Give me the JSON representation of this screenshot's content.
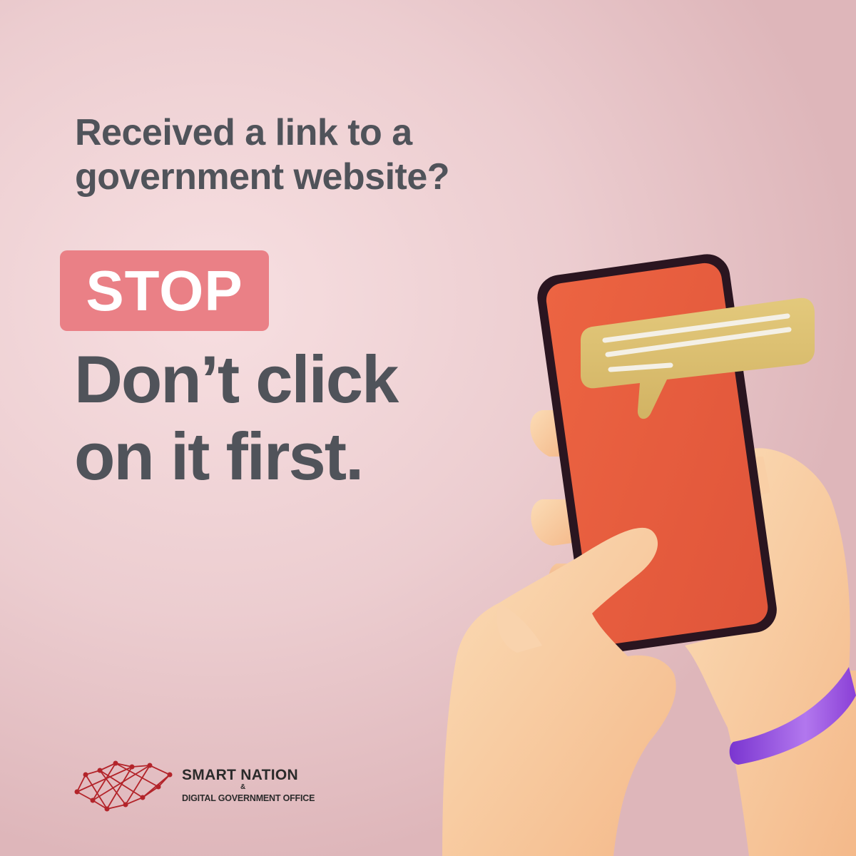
{
  "headline": {
    "question_line1": "Received a link to a",
    "question_line2": "government website?"
  },
  "stop_badge": {
    "label": "STOP",
    "color": "#ea8086"
  },
  "warning": {
    "line1": "Don’t click",
    "line2": "on it first."
  },
  "logo": {
    "line1": "SMART NATION",
    "ampersand": "&",
    "line2": "DIGITAL GOVERNMENT OFFICE",
    "icon": "network-map-icon",
    "color": "#b3242a"
  },
  "illustration": {
    "icon": "hand-holding-phone-illustration",
    "phone_screen_color": "#e85e3d",
    "chat_bubble_color": "#dcc06f",
    "wristband_color": "#8a3fd6"
  },
  "colors": {
    "text": "#50535a",
    "background": "#f0d3d6"
  }
}
